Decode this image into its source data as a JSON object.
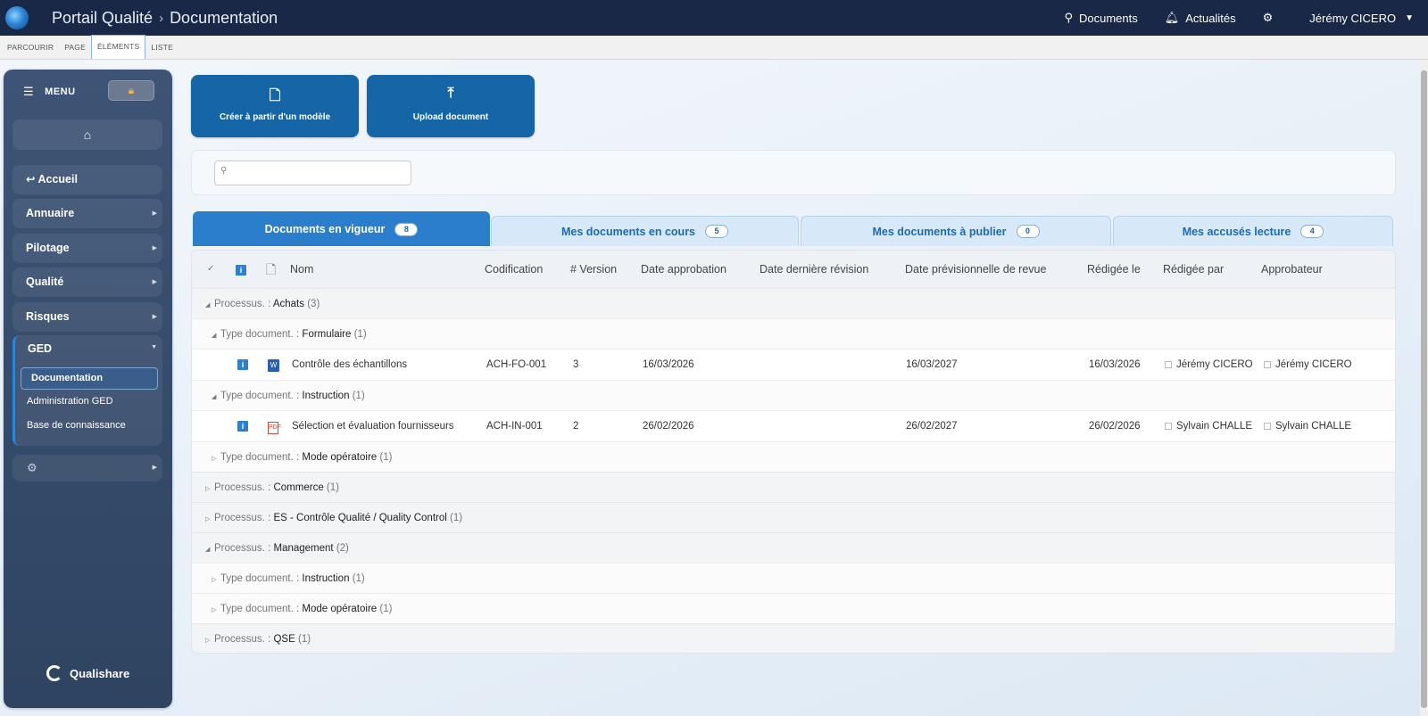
{
  "topbar": {
    "app_title": "Portail Qualité",
    "separator": "›",
    "section": "Documentation",
    "documents_label": "Documents",
    "news_label": "Actualités",
    "user_name": "Jérémy CICERO"
  },
  "ribbon": {
    "tabs": [
      "PARCOURIR",
      "PAGE",
      "ÉLÉMENTS",
      "LISTE"
    ],
    "active": "ÉLÉMENTS"
  },
  "sidebar": {
    "menu_label": "MENU",
    "items": [
      {
        "label": "↩ Accueil"
      },
      {
        "label": "Annuaire"
      },
      {
        "label": "Pilotage"
      },
      {
        "label": "Qualité"
      },
      {
        "label": "Risques"
      }
    ],
    "ged": {
      "label": "GED",
      "subitems": [
        "Documentation",
        "Administration GED",
        "Base de connaissance"
      ]
    },
    "brand": "Qualishare"
  },
  "actions": {
    "create_label": "Créer à partir d'un modèle",
    "upload_label": "Upload document"
  },
  "search": {
    "placeholder": "",
    "value": ""
  },
  "tabs": [
    {
      "label": "Documents en vigueur",
      "count": "8"
    },
    {
      "label": "Mes documents en cours",
      "count": "5"
    },
    {
      "label": "Mes documents à publier",
      "count": "0"
    },
    {
      "label": "Mes accusés lecture",
      "count": "4"
    }
  ],
  "grid": {
    "columns": [
      "Nom",
      "Codification",
      "# Version",
      "Date approbation",
      "Date dernière révision",
      "Date prévisionnelle de revue",
      "Rédigée le",
      "Rédigée par",
      "Approbateur"
    ],
    "process_label": "Processus. :",
    "type_label": "Type document. :",
    "groups": [
      {
        "name": "Achats",
        "count": "(3)"
      },
      {
        "name": "Commerce",
        "count": "(1)"
      },
      {
        "name": "ES - Contrôle Qualité / Quality Control",
        "count": "(1)"
      },
      {
        "name": "Management",
        "count": "(2)"
      },
      {
        "name": "QSE",
        "count": "(1)"
      }
    ],
    "subgroups": [
      {
        "name": "Formulaire",
        "count": "(1)"
      },
      {
        "name": "Instruction",
        "count": "(1)"
      },
      {
        "name": "Mode opératoire",
        "count": "(1)"
      },
      {
        "name": "Instruction",
        "count": "(1)"
      },
      {
        "name": "Mode opératoire",
        "count": "(1)"
      }
    ],
    "rows": [
      {
        "nom": "Contrôle des échantillons",
        "code": "ACH-FO-001",
        "version": "3",
        "date_approbation": "16/03/2026",
        "date_revision": "",
        "date_revue": "16/03/2027",
        "redigee_le": "16/03/2026",
        "redigee_par": "Jérémy CICERO",
        "approbateur": "Jérémy CICERO"
      },
      {
        "nom": "Sélection et évaluation fournisseurs",
        "code": "ACH-IN-001",
        "version": "2",
        "date_approbation": "26/02/2026",
        "date_revision": "",
        "date_revue": "26/02/2027",
        "redigee_le": "26/02/2026",
        "redigee_par": "Sylvain CHALLE",
        "approbateur": "Sylvain CHALLE"
      }
    ]
  }
}
